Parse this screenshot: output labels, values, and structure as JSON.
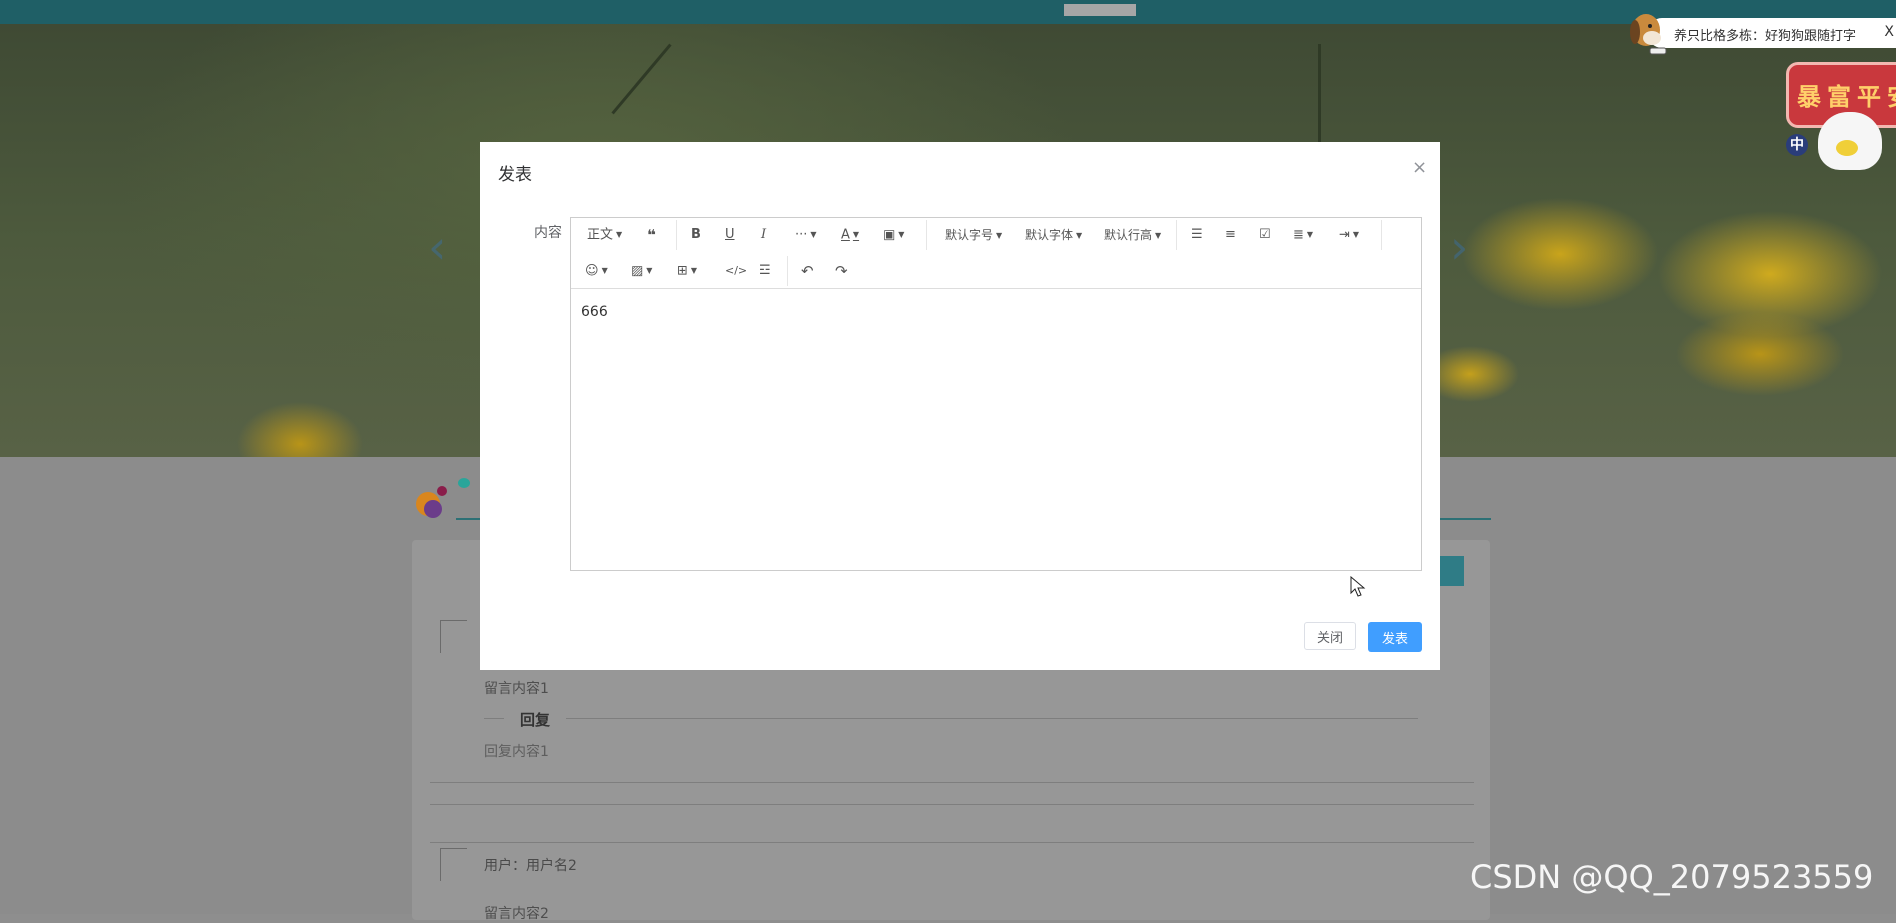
{
  "notice": {
    "text": "养只比格多栋：好狗狗跟随打字",
    "close": "X"
  },
  "badge": {
    "text": "暴富平安",
    "tag": "中"
  },
  "carousel": {
    "prev": "‹",
    "next": "›"
  },
  "messages": [
    {
      "content": "留言内容1",
      "reply_title": "回复",
      "reply_content": "回复内容1"
    },
    {
      "user": "用户：用户名2",
      "content": "留言内容2"
    }
  ],
  "dialog": {
    "title": "发表",
    "close_icon": "×",
    "field_label": "内容",
    "editor_content": "666",
    "toolbar": {
      "paragraph": "正文",
      "font_size": "默认字号",
      "font_family": "默认字体",
      "line_height": "默认行高"
    },
    "cancel_label": "关闭",
    "submit_label": "发表"
  },
  "watermark": "CSDN @QQ_2079523559"
}
